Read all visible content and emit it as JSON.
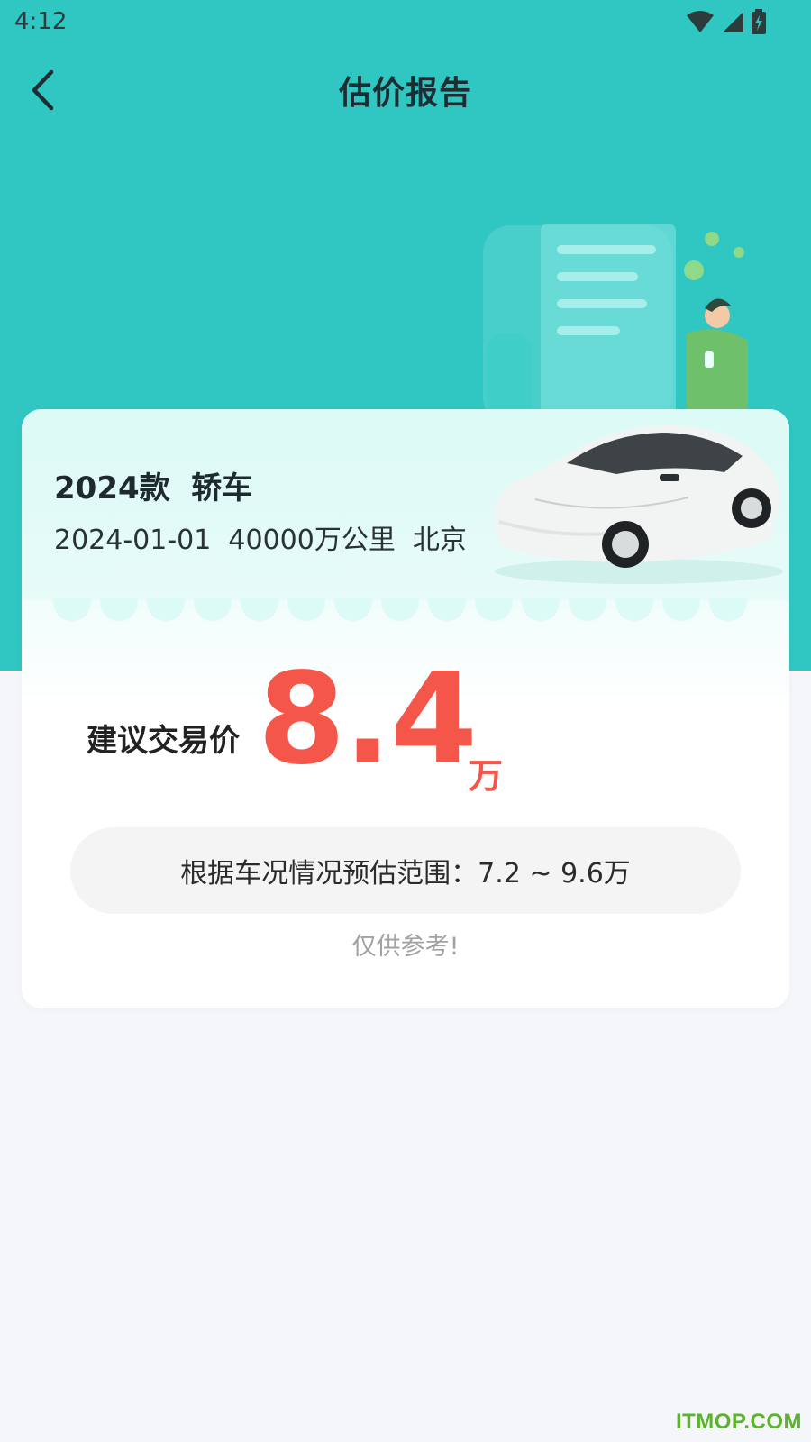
{
  "status_bar": {
    "time": "4:12",
    "icons": [
      "wifi-icon",
      "signal-icon",
      "battery-icon"
    ]
  },
  "nav": {
    "back_icon": "chevron-left-icon",
    "title": "估价报告"
  },
  "car": {
    "title": "2024款  轿车",
    "meta": "2024-01-01  40000万公里  北京"
  },
  "price": {
    "label": "建议交易价",
    "value": "8.4",
    "unit": "万"
  },
  "range": {
    "text": "根据车况情况预估范围：7.2 ~ 9.6万"
  },
  "disclaimer": "仅供参考!",
  "watermark": "ITMOP.COM",
  "colors": {
    "header_bg": "#30c6c2",
    "price_accent": "#f4574a",
    "page_bg": "#f4f6fa"
  }
}
